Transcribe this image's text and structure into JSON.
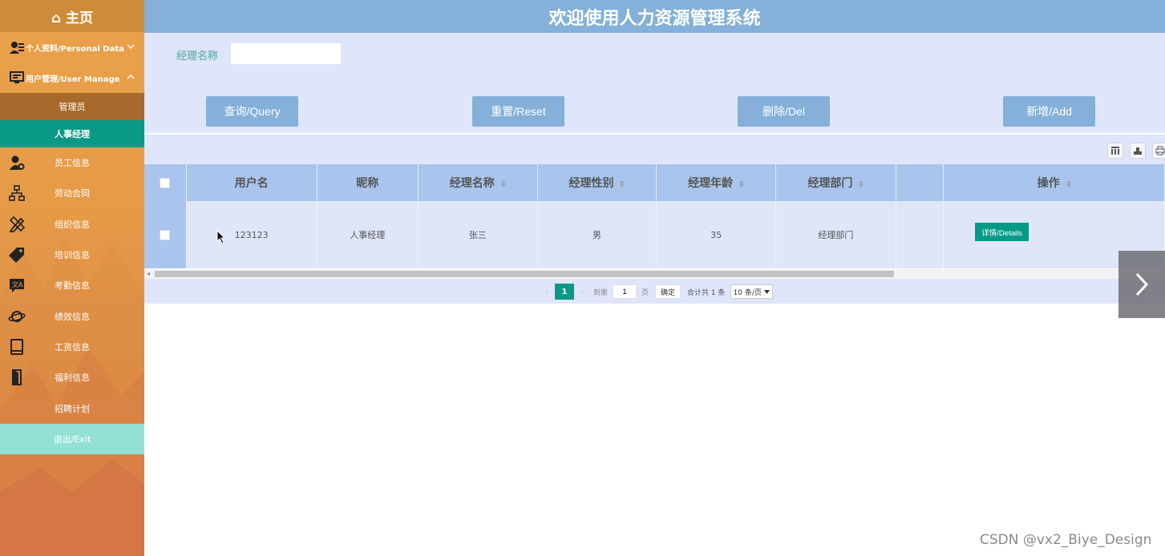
{
  "sidebar": {
    "home_label": "⌂ 主页",
    "groups": [
      {
        "label": "个人资料/Personal Data",
        "icon": "user-card-icon",
        "chevron": "down"
      },
      {
        "label": "用户管理/User Manage",
        "icon": "monitor-icon",
        "chevron": "up"
      }
    ],
    "subitems": [
      {
        "label": "管理员",
        "active": false
      },
      {
        "label": "人事经理",
        "active": true
      }
    ],
    "items": [
      {
        "label": "员工信息",
        "icon": "user-gear-icon"
      },
      {
        "label": "劳动合同",
        "icon": "org-chart-icon"
      },
      {
        "label": "组织信息",
        "icon": "pencil-ruler-icon"
      },
      {
        "label": "培训信息",
        "icon": "tag-icon"
      },
      {
        "label": "考勤信息",
        "icon": "translate-icon"
      },
      {
        "label": "绩效信息",
        "icon": "planet-icon"
      },
      {
        "label": "工资信息",
        "icon": "book-icon"
      },
      {
        "label": "福利信息",
        "icon": "door-icon"
      },
      {
        "label": "招聘计划",
        "icon": ""
      }
    ],
    "exit_label": "退出/Exit"
  },
  "header": {
    "title": "欢迎使用人力资源管理系统"
  },
  "search": {
    "label": "经理名称",
    "value": "",
    "placeholder": ""
  },
  "buttons": {
    "query": "查询/Query",
    "reset": "重置/Reset",
    "delete": "删除/Del",
    "add": "新增/Add"
  },
  "table": {
    "columns": [
      {
        "label": "用户名",
        "sortable": false
      },
      {
        "label": "昵称",
        "sortable": false
      },
      {
        "label": "经理名称",
        "sortable": true
      },
      {
        "label": "经理性别",
        "sortable": true
      },
      {
        "label": "经理年龄",
        "sortable": true
      },
      {
        "label": "经理部门",
        "sortable": true
      },
      {
        "label": "",
        "sortable": false
      },
      {
        "label": "操作",
        "sortable": true
      }
    ],
    "rows": [
      {
        "username": "123123",
        "nickname": "人事经理",
        "name": "张三",
        "gender": "男",
        "age": "35",
        "dept": "经理部门",
        "action": "详情/Details"
      }
    ]
  },
  "pager": {
    "current": "1",
    "goto_prefix": "到第",
    "goto_value": "1",
    "goto_suffix": "页",
    "confirm": "确定",
    "total": "合计共 1 条",
    "page_size": "10 条/页"
  },
  "watermark": "CSDN @vx2_Biye_Design",
  "colors": {
    "accent": "#059a87",
    "header": "#84b0d9",
    "sidebar": "#e59a48",
    "panel": "#dfe5fb"
  }
}
